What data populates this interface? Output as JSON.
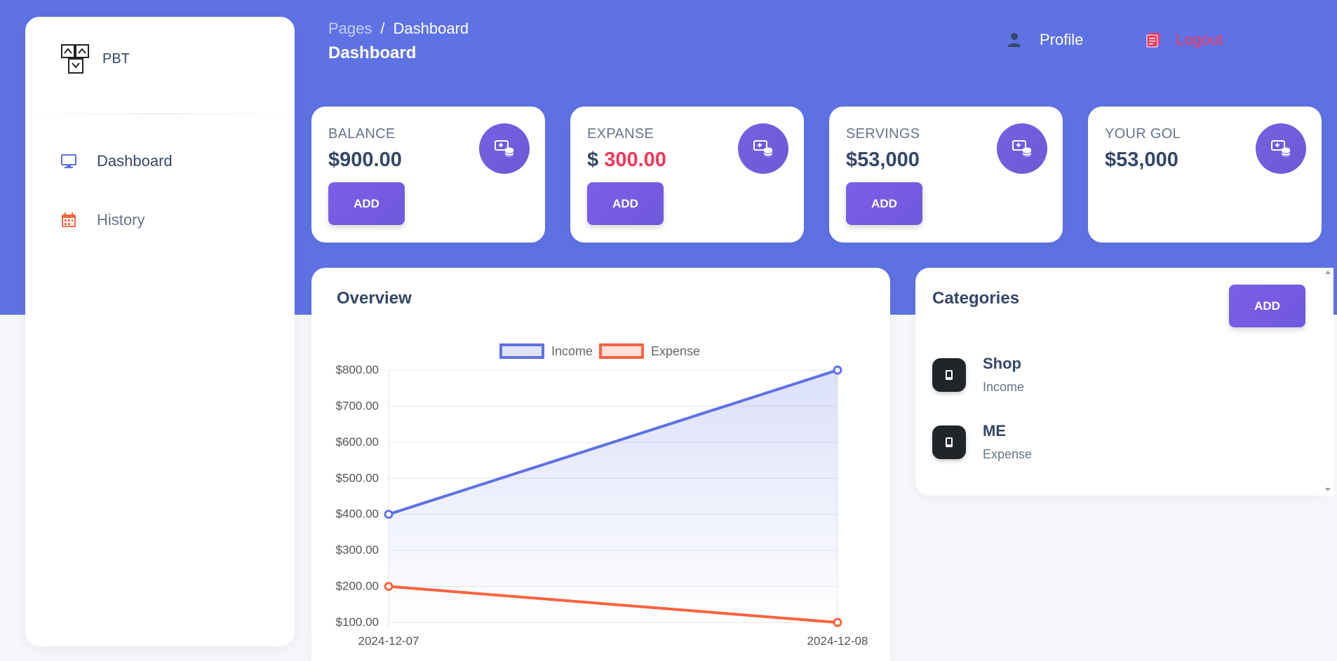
{
  "brand": {
    "name": "PBT"
  },
  "sidebar": {
    "items": [
      {
        "label": "Dashboard",
        "icon": "monitor-icon",
        "active": true
      },
      {
        "label": "History",
        "icon": "calendar-icon",
        "active": false
      }
    ]
  },
  "header": {
    "breadcrumb": {
      "parent": "Pages",
      "separator": "/",
      "current": "Dashboard"
    },
    "title": "Dashboard",
    "profile_label": "Profile",
    "logout_label": "Logout"
  },
  "stats": [
    {
      "title": "BALANCE",
      "value": "$900.00",
      "button": "ADD"
    },
    {
      "title": "EXPANSE",
      "value_prefix": "$ ",
      "value_neg": "300.00",
      "button": "ADD"
    },
    {
      "title": "SERVINGS",
      "value": "$53,000",
      "button": "ADD"
    },
    {
      "title": "YOUR GOL",
      "value": "$53,000"
    }
  ],
  "overview": {
    "title": "Overview"
  },
  "categories": {
    "title": "Categories",
    "add_label": "ADD",
    "items": [
      {
        "name": "Shop",
        "type": "Income"
      },
      {
        "name": "ME",
        "type": "Expense"
      }
    ]
  },
  "colors": {
    "primary": "#5e72e4",
    "income": "#5e72e4",
    "expense": "#fb6340",
    "danger": "#f5365c",
    "button": "#7460e0"
  },
  "chart_data": {
    "type": "line",
    "x": [
      "2024-12-07",
      "2024-12-08"
    ],
    "series": [
      {
        "name": "Income",
        "values": [
          400,
          800
        ],
        "color": "#5e72e4",
        "fill": true
      },
      {
        "name": "Expense",
        "values": [
          200,
          100
        ],
        "color": "#fb6340",
        "fill": false
      }
    ],
    "ylim": [
      100,
      800
    ],
    "yticks": [
      100,
      200,
      300,
      400,
      500,
      600,
      700,
      800
    ],
    "ytick_labels": [
      "$100.00",
      "$200.00",
      "$300.00",
      "$400.00",
      "$500.00",
      "$600.00",
      "$700.00",
      "$800.00"
    ],
    "legend": "top-center",
    "grid": true
  }
}
